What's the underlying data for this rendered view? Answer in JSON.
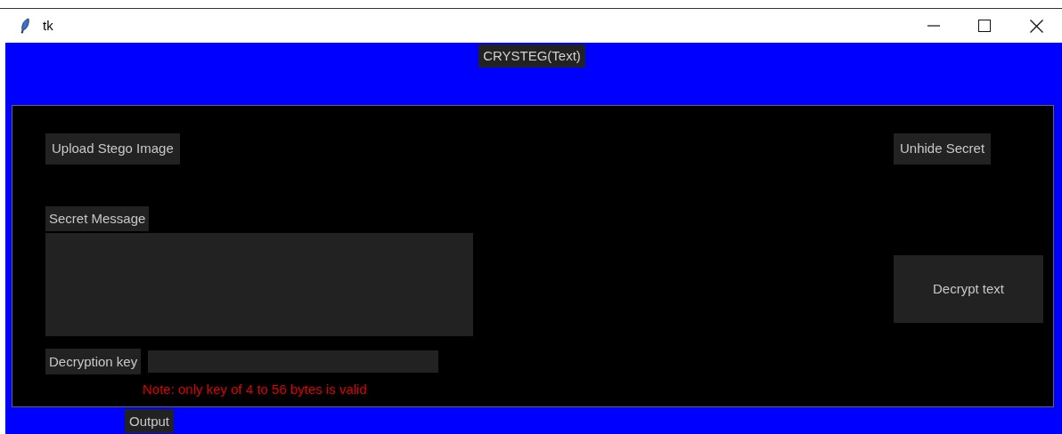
{
  "window": {
    "title": "tk"
  },
  "header": {
    "title": "CRYSTEG(Text)"
  },
  "upload_button": "Upload Stego Image",
  "unhide_button": "Unhide Secret",
  "secret_message": {
    "label": "Secret Message"
  },
  "decrypt_button": "Decrypt text",
  "decryption_key": {
    "label": "Decryption key"
  },
  "note": "Note: only key of 4 to 56 bytes is valid",
  "output_label": "Output"
}
